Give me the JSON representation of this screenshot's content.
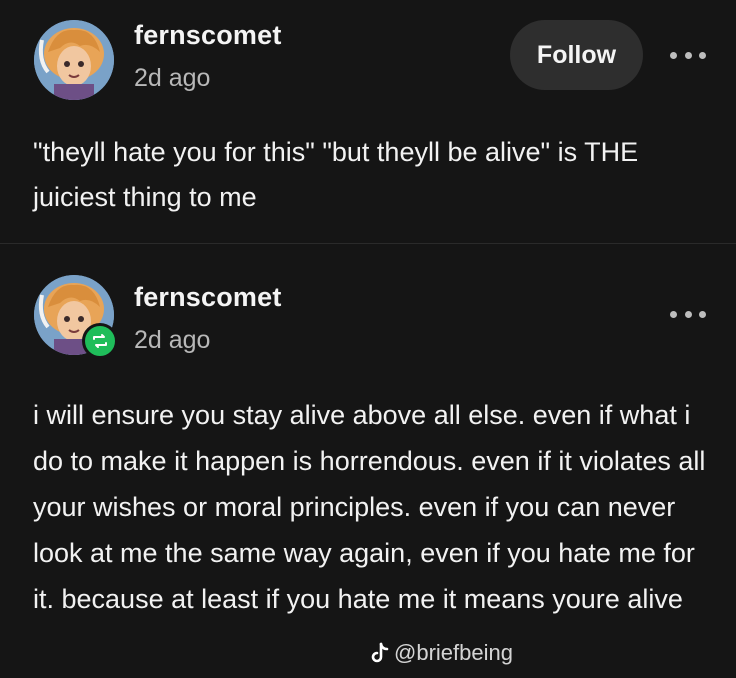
{
  "post": {
    "username": "fernscomet",
    "timestamp": "2d ago",
    "follow_label": "Follow",
    "more_icon": "more-horizontal-icon",
    "body": "\"theyll hate you for this\" \"but theyll be alive\" is THE juiciest thing to me"
  },
  "reblog": {
    "username": "fernscomet",
    "timestamp": "2d ago",
    "badge_icon": "reblog-icon",
    "badge_color": "#1fbd5a",
    "more_icon": "more-horizontal-icon",
    "body": "i will ensure you stay alive above all else. even if what i do to make it happen is horrendous. even if it violates all your wishes or moral principles. even if you can never look at me the same way again, even if you hate me for it. because at least if you hate me it means youre alive"
  },
  "watermark": {
    "icon": "tiktok-icon",
    "text": "@briefbeing"
  },
  "colors": {
    "background": "#151515",
    "button": "#2e2e2e",
    "text": "#f2f2f2",
    "muted": "#b8b8b8"
  }
}
